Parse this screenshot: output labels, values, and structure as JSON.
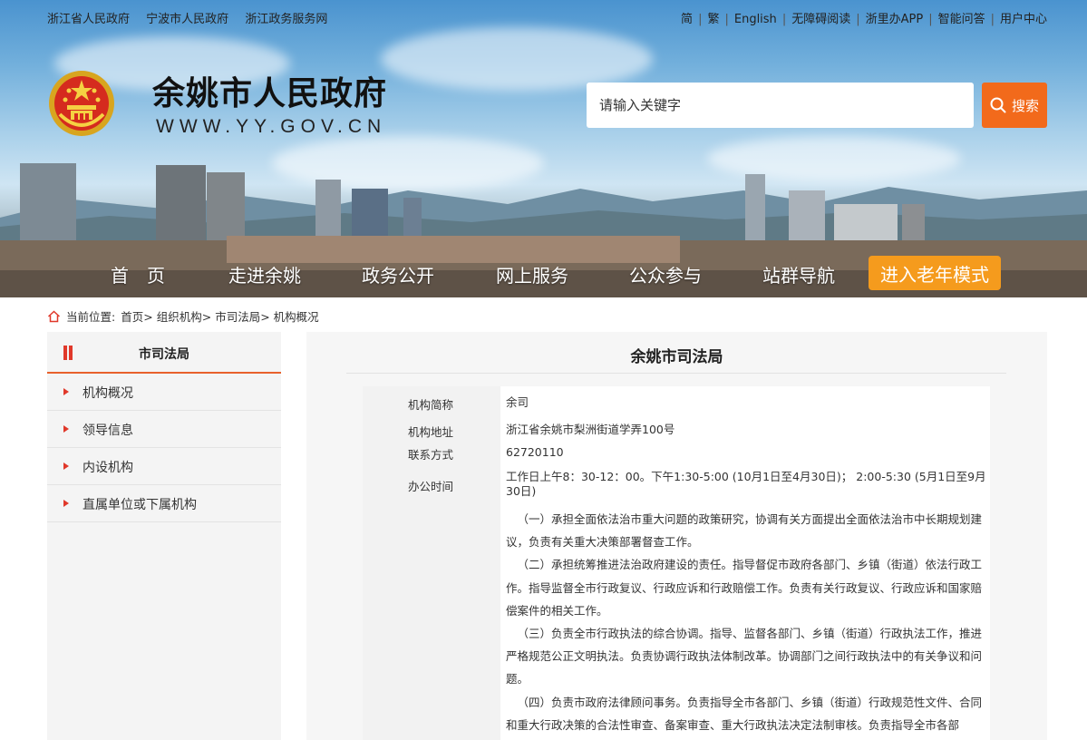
{
  "top_links_left": [
    "浙江省人民政府",
    "宁波市人民政府",
    "浙江政务服务网"
  ],
  "top_links_right": [
    "简",
    "繁",
    "English",
    "无障碍阅读",
    "浙里办APP",
    "智能问答",
    "用户中心"
  ],
  "site": {
    "title": "余姚市人民政府",
    "url": "WWW.YY.GOV.CN"
  },
  "search": {
    "placeholder": "请输入关键字",
    "button_label": "搜索"
  },
  "nav": {
    "items": [
      "首　页",
      "走进余姚",
      "政务公开",
      "网上服务",
      "公众参与",
      "站群导航"
    ],
    "elder_mode": "进入老年模式"
  },
  "breadcrumb": {
    "prefix": "当前位置:",
    "items": [
      "首页>",
      "组织机构>",
      "市司法局>",
      "机构概况"
    ]
  },
  "sidebar": {
    "title": "市司法局",
    "items": [
      "机构概况",
      "领导信息",
      "内设机构",
      "直属单位或下属机构"
    ]
  },
  "main": {
    "title": "余姚市司法局",
    "info": [
      {
        "key": "机构简称",
        "value": "余司"
      },
      {
        "key": "机构地址",
        "value": "浙江省余姚市梨洲街道学弄100号"
      },
      {
        "key": "联系方式",
        "value": "62720110"
      },
      {
        "key": "办公时间",
        "value": "工作日上午8：30-12：00。下午1:30-5:00 (10月1日至4月30日)； 2:00-5:30 (5月1日至9月30日)"
      }
    ],
    "duties": [
      "（一）承担全面依法治市重大问题的政策研究，协调有关方面提出全面依法治市中长期规划建议，负责有关重大决策部署督查工作。",
      "（二）承担统筹推进法治政府建设的责任。指导督促市政府各部门、乡镇（街道）依法行政工作。指导监督全市行政复议、行政应诉和行政赔偿工作。负责有关行政复议、行政应诉和国家赔偿案件的相关工作。",
      "（三）负责全市行政执法的综合协调。指导、监督各部门、乡镇（街道）行政执法工作，推进严格规范公正文明执法。负责协调行政执法体制改革。协调部门之间行政执法中的有关争议和问题。",
      "（四）负责市政府法律顾问事务。负责指导全市各部门、乡镇（街道）行政规范性文件、合同和重大行政决策的合法性审查、备案审查、重大行政执法决定法制审核。负责指导全市各部"
    ]
  },
  "colors": {
    "accent_orange": "#f26a1b",
    "elder_orange": "#f59b1d",
    "sidebar_rule": "#e8612c",
    "arrow_red": "#e0382a"
  }
}
